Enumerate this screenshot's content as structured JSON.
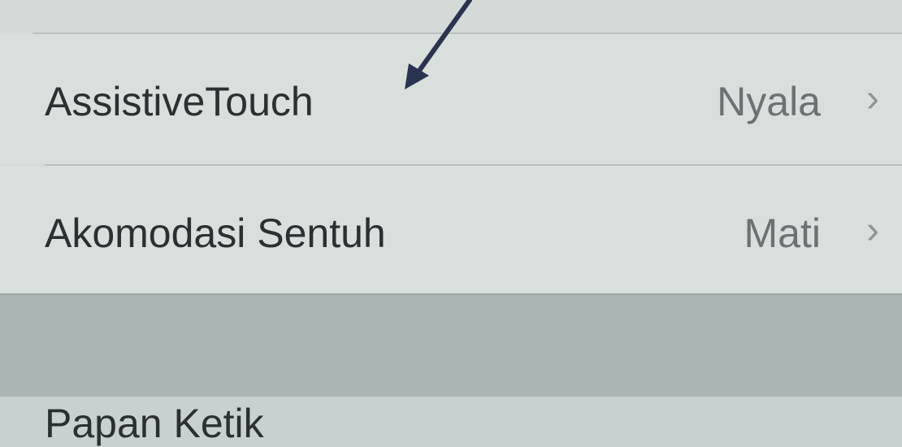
{
  "settings": {
    "rows": [
      {
        "label": "AssistiveTouch",
        "value": "Nyala"
      },
      {
        "label": "Akomodasi Sentuh",
        "value": "Mati"
      }
    ],
    "next_section_row": {
      "label": "Papan Ketik"
    }
  },
  "icons": {
    "chevron": "chevron-right-icon",
    "annotation": "arrow-annotation"
  },
  "colors": {
    "annotation_arrow": "#2a3350"
  }
}
